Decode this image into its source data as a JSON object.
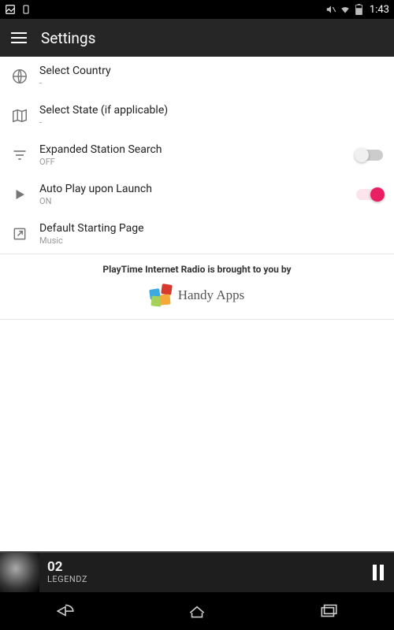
{
  "status": {
    "time": "1:43"
  },
  "header": {
    "title": "Settings"
  },
  "settings": {
    "country": {
      "title": "Select Country",
      "sub": "-"
    },
    "state": {
      "title": "Select State (if applicable)",
      "sub": "-"
    },
    "expanded": {
      "title": "Expanded Station Search",
      "sub": "OFF"
    },
    "autoplay": {
      "title": "Auto Play upon Launch",
      "sub": "ON"
    },
    "startpage": {
      "title": "Default Starting Page",
      "sub": "Music"
    }
  },
  "promo": {
    "tagline": "PlayTime Internet Radio is brought to you by",
    "brand": "Handy Apps"
  },
  "player": {
    "track_no": "02",
    "track_name": "LEGENDZ"
  }
}
